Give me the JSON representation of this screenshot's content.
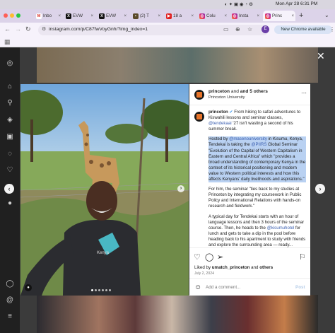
{
  "menubar": {
    "datetime": "Mon Apr 28 6:31 PM"
  },
  "tabs": [
    {
      "label": "Inbo",
      "color": "#d93025",
      "glyph": "M"
    },
    {
      "label": "EVW",
      "color": "#111111",
      "glyph": "X"
    },
    {
      "label": "EVW",
      "color": "#111111",
      "glyph": "X"
    },
    {
      "label": "(2) T",
      "color": "#333333",
      "glyph": "◼"
    },
    {
      "label": "18 a",
      "color": "#e02020",
      "glyph": "▶"
    },
    {
      "label": "Colu",
      "color": "#d6249f",
      "glyph": "◎"
    },
    {
      "label": "Insta",
      "color": "#d6249f",
      "glyph": "◎"
    },
    {
      "label": "Princ",
      "color": "#d6249f",
      "glyph": "◎"
    }
  ],
  "toolbar": {
    "url": "instagram.com/p/C87fwVoyGnh/?img_index=1",
    "profile_initial": "E",
    "new_chrome": "New Chrome available"
  },
  "post": {
    "author": "princeton",
    "and_others": "and 5 others",
    "subtitle": "Princeton University",
    "caption_author": "princeton",
    "caption_p1": "From hiking to safari adventures to Kiswahili lessons and seminar classes,",
    "caption_p1_mention": "@tendekaai",
    "caption_p1_rest": "'27 isn't wasting a second of his summer break.",
    "caption_p2_a": "Hosted by",
    "caption_p2_m1": "@masenouniversity",
    "caption_p2_b": "in Kisumu, Kenya, Tendekai is taking the",
    "caption_p2_m2": "@PIIRS",
    "caption_p2_c": "Global Seminar \"Evolution of the Capital of Western Capitalism in Eastern and Central Africa\" which \"provides a broad understanding of contemporary Kenya in the context of its historical positioning and modern value to Western political interests and how this affects Kenyans' daily livelihoods and aspirations.\"",
    "caption_p3": "For him, the seminar \"ties back to my studies at Princeton by integrating my coursework in Public Policy and International Relations with hands-on research and fieldwork.\"",
    "caption_p4_a": "A typical day for Tendekai starts with an hour of language lessons and then 3 hours of the seminar course. Then, he heads to the",
    "caption_p4_m": "@kisumuhotel",
    "caption_p4_b": "for lunch and gets to take a dip in the pool before heading back to his apartment to study with friends and explore the surrounding area — ready...",
    "liked_prefix": "Liked by",
    "liked_user": "umatch_princeton",
    "liked_and": "and",
    "liked_others": "others",
    "date": "July 2, 2024",
    "comment_placeholder": "Add a comment...",
    "post_label": "Post"
  },
  "shirt_text": "Kenya"
}
